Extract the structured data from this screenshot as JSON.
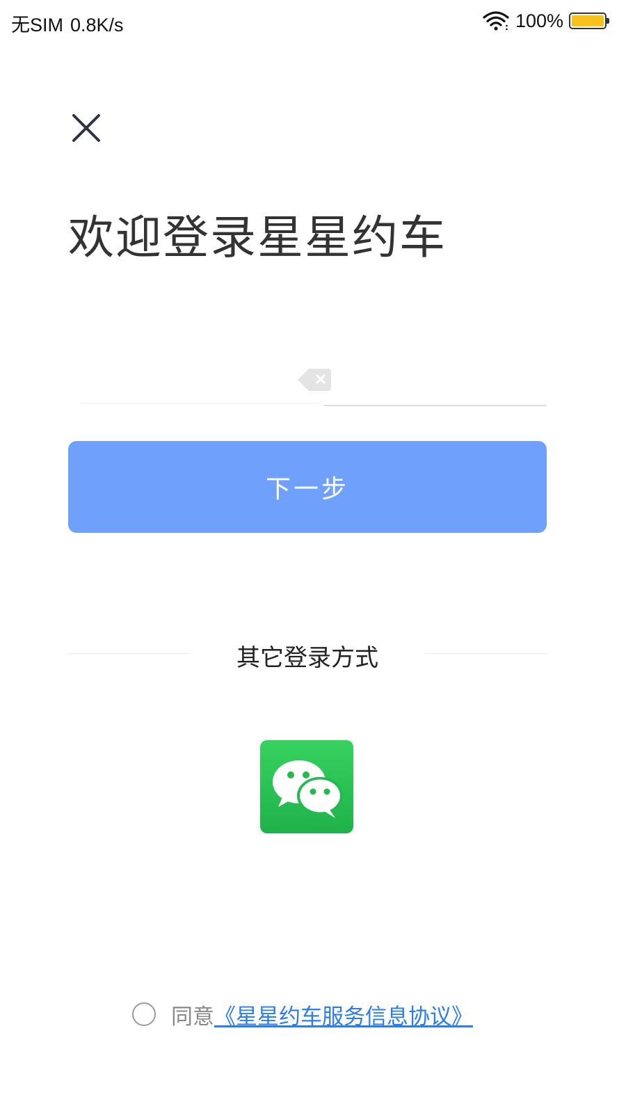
{
  "status_bar": {
    "carrier": "无SIM",
    "network_speed": "0.8K/s",
    "battery_percent": "100%",
    "battery_level": 1.0,
    "battery_color": "#f7c21b",
    "wifi_icon": "wifi-icon"
  },
  "close": {
    "icon": "close-icon"
  },
  "title": "欢迎登录星星约车",
  "phone_input": {
    "value": "",
    "placeholder": "",
    "clear_icon": "clear-icon"
  },
  "next_button": {
    "label": "下一步",
    "color": "#6fa0fb"
  },
  "other_login": {
    "label": "其它登录方式",
    "methods": [
      {
        "name": "wechat",
        "icon": "wechat-icon",
        "color": "#28c054"
      }
    ]
  },
  "agreement": {
    "checked": false,
    "prefix": "同意",
    "link_text": "《星星约车服务信息协议》",
    "link_color": "#2b7de9"
  }
}
